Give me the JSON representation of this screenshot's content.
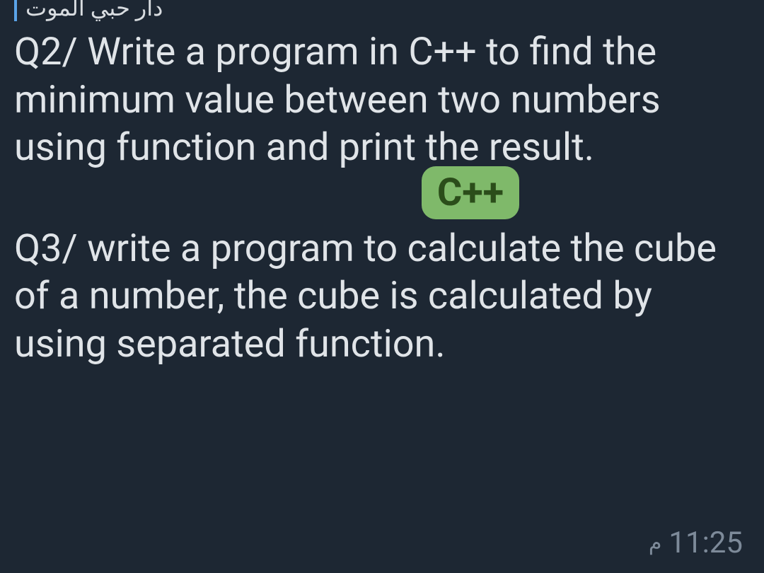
{
  "reply": {
    "preview_text": "دار حبي الموت"
  },
  "message": {
    "question2": "Q2/ Write a program in C++ to find the minimum value between two numbers using function and print the result.",
    "badge": "C++",
    "question3": "Q3/ write a program to calculate the cube of a number, the cube is calculated by using separated function."
  },
  "timestamp": {
    "time": "11:25",
    "meridiem": "م"
  }
}
